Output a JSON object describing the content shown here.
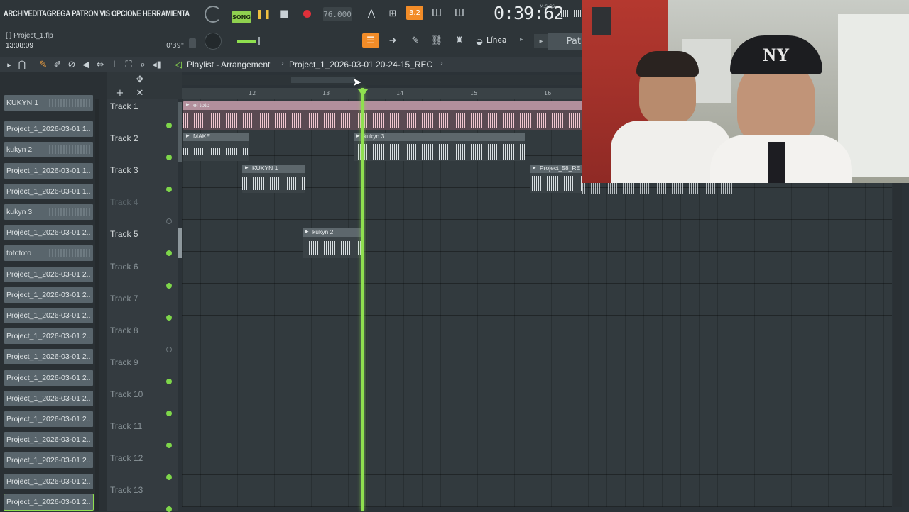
{
  "menu": {
    "items": [
      "ARCHIV",
      "EDITA",
      "GREGA",
      "PATRON",
      "VIS",
      "OPCIONE",
      "HERRAMIENTA"
    ]
  },
  "transport": {
    "song_label": "SONG",
    "tempo": "76.000",
    "time": "0:39:62",
    "time_unit": "M:S:CS",
    "snap_value": "3.2"
  },
  "project": {
    "file": "Project_1.flp",
    "elapsed": "13:08:09",
    "position": "0'39\"",
    "snap_mode": "Línea",
    "pattern_label": "Pat"
  },
  "playlist": {
    "title": "Playlist - Arrangement",
    "breadcrumb": "Project_1_2026-03-01 20-24-15_REC"
  },
  "ruler": [
    "12",
    "13",
    "14",
    "15",
    "16"
  ],
  "browser": {
    "items": [
      {
        "label": "KUKYN 1"
      },
      {
        "label": "Project_1_2026-03-01 1.."
      },
      {
        "label": "kukyn 2"
      },
      {
        "label": "Project_1_2026-03-01 1.."
      },
      {
        "label": "Project_1_2026-03-01 1.."
      },
      {
        "label": "kukyn 3"
      },
      {
        "label": "Project_1_2026-03-01 2.."
      },
      {
        "label": "totototo"
      },
      {
        "label": "Project_1_2026-03-01 2.."
      },
      {
        "label": "Project_1_2026-03-01 2.."
      },
      {
        "label": "Project_1_2026-03-01 2.."
      },
      {
        "label": "Project_1_2026-03-01 2.."
      },
      {
        "label": "Project_1_2026-03-01 2.."
      },
      {
        "label": "Project_1_2026-03-01 2.."
      },
      {
        "label": "Project_1_2026-03-01 2.."
      },
      {
        "label": "Project_1_2026-03-01 2.."
      },
      {
        "label": "Project_1_2026-03-01 2.."
      },
      {
        "label": "Project_1_2026-03-01 2.."
      },
      {
        "label": "Project_1_2026-03-01 2.."
      },
      {
        "label": "Project_1_2026-03-01 2.."
      }
    ]
  },
  "tracks": [
    {
      "name": "Track 1",
      "active": true
    },
    {
      "name": "Track 2",
      "active": true
    },
    {
      "name": "Track 3",
      "active": true
    },
    {
      "name": "Track 4",
      "active": false
    },
    {
      "name": "Track 5",
      "active": true
    },
    {
      "name": "Track 6",
      "active": false
    },
    {
      "name": "Track 7",
      "active": false
    },
    {
      "name": "Track 8",
      "active": false
    },
    {
      "name": "Track 9",
      "active": false
    },
    {
      "name": "Track 10",
      "active": false
    },
    {
      "name": "Track 11",
      "active": false
    },
    {
      "name": "Track 12",
      "active": false
    },
    {
      "name": "Track 13",
      "active": false
    }
  ],
  "clips": {
    "el_toto": "el toto",
    "make": "MAKE",
    "kukyn3": "kukyn 3",
    "kukyn1": "KUKYN 1",
    "project58": "Project_58_RE",
    "kukyn2": "kukyn 2"
  },
  "colors": {
    "accent_green": "#8fe04f",
    "accent_orange": "#f28c28",
    "record_red": "#e0303a"
  },
  "webcam": {
    "cap_logo": "NY"
  }
}
